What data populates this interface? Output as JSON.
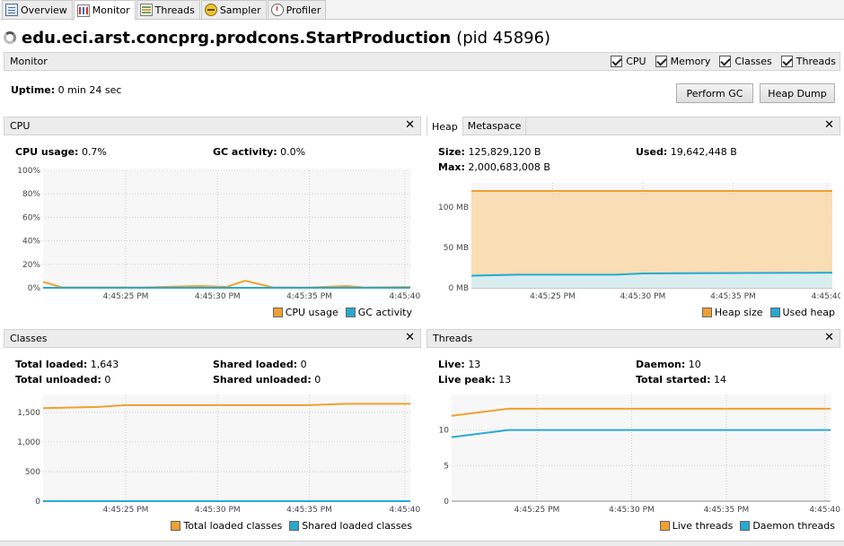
{
  "tabs": [
    {
      "label": "Overview"
    },
    {
      "label": "Monitor"
    },
    {
      "label": "Threads"
    },
    {
      "label": "Sampler"
    },
    {
      "label": "Profiler"
    }
  ],
  "app": {
    "title": "edu.eci.arst.concprg.prodcons.StartProduction",
    "pid": "(pid 45896)"
  },
  "monitor": {
    "label": "Monitor",
    "checks": [
      "CPU",
      "Memory",
      "Classes",
      "Threads"
    ],
    "uptime_label": "Uptime:",
    "uptime_value": "0 min 24 sec",
    "perform_gc": "Perform GC",
    "heap_dump": "Heap Dump"
  },
  "colors": {
    "orange": "#f0a030",
    "blue": "#28a8d0",
    "orange_fill": "#f8d9ad",
    "blue_fill": "#d6eff6"
  },
  "cpu": {
    "title": "CPU",
    "usage_label": "CPU usage:",
    "usage_value": "0.7%",
    "gc_label": "GC activity:",
    "gc_value": "0.0%",
    "legend": [
      "CPU usage",
      "GC activity"
    ]
  },
  "heap": {
    "tab_heap": "Heap",
    "tab_meta": "Metaspace",
    "size_label": "Size:",
    "size_value": "125,829,120 B",
    "used_label": "Used:",
    "used_value": "19,642,448 B",
    "max_label": "Max:",
    "max_value": "2,000,683,008 B",
    "legend": [
      "Heap size",
      "Used heap"
    ]
  },
  "classes": {
    "title": "Classes",
    "total_loaded_label": "Total loaded:",
    "total_loaded_value": "1,643",
    "total_unloaded_label": "Total unloaded:",
    "total_unloaded_value": "0",
    "shared_loaded_label": "Shared loaded:",
    "shared_loaded_value": "0",
    "shared_unloaded_label": "Shared unloaded:",
    "shared_unloaded_value": "0",
    "legend": [
      "Total loaded classes",
      "Shared loaded classes"
    ]
  },
  "threads": {
    "title": "Threads",
    "live_label": "Live:",
    "live_value": "13",
    "peak_label": "Live peak:",
    "peak_value": "13",
    "daemon_label": "Daemon:",
    "daemon_value": "10",
    "started_label": "Total started:",
    "started_value": "14",
    "legend": [
      "Live threads",
      "Daemon threads"
    ]
  },
  "chart_data": [
    {
      "type": "line",
      "name": "cpu",
      "x_ticks": [
        "4:45:25 PM",
        "4:45:30 PM",
        "4:45:35 PM",
        "4:45:40"
      ],
      "y_ticks": [
        "100%",
        "80%",
        "60%",
        "40%",
        "20%",
        "0%"
      ],
      "ylim": [
        0,
        100
      ],
      "xlim": [
        20.5,
        40.5
      ],
      "series": [
        {
          "name": "CPU usage",
          "x": [
            20.5,
            21.5,
            26,
            29,
            30.5,
            31.5,
            33,
            35,
            37,
            38,
            40.5
          ],
          "values": [
            5,
            0.5,
            0.3,
            1.5,
            0.8,
            6,
            0.4,
            0.2,
            1.5,
            0.3,
            0.7
          ]
        },
        {
          "name": "GC activity",
          "x": [
            20.5,
            40.5
          ],
          "values": [
            0,
            0
          ]
        }
      ]
    },
    {
      "type": "area",
      "name": "heap",
      "x_ticks": [
        "4:45:25 PM",
        "4:45:30 PM",
        "4:45:35 PM",
        "4:45:40"
      ],
      "y_ticks": [
        "100 MB",
        "50 MB",
        "0 MB"
      ],
      "ylim": [
        0,
        130
      ],
      "xlim": [
        20.5,
        40.5
      ],
      "series": [
        {
          "name": "Heap size",
          "x": [
            20.5,
            40.5
          ],
          "values": [
            120,
            120
          ]
        },
        {
          "name": "Used heap",
          "x": [
            20.5,
            23,
            28.5,
            30,
            40.5
          ],
          "values": [
            15,
            16.3,
            16.3,
            17.8,
            18.7
          ]
        }
      ]
    },
    {
      "type": "line",
      "name": "classes",
      "x_ticks": [
        "4:45:25 PM",
        "4:45:30 PM",
        "4:45:35 PM",
        "4:45:40"
      ],
      "y_ticks": [
        "1,500",
        "1,000",
        "500",
        "0"
      ],
      "ylim": [
        0,
        1800
      ],
      "xlim": [
        20.5,
        40.5
      ],
      "series": [
        {
          "name": "Total loaded classes",
          "x": [
            20.5,
            23.5,
            25,
            35,
            37,
            40.5
          ],
          "values": [
            1570,
            1590,
            1620,
            1620,
            1643,
            1643
          ]
        },
        {
          "name": "Shared loaded classes",
          "x": [
            20.5,
            40.5
          ],
          "values": [
            0,
            0
          ]
        }
      ]
    },
    {
      "type": "line",
      "name": "threads",
      "x_ticks": [
        "4:45:25 PM",
        "4:45:30 PM",
        "4:45:35 PM",
        "4:45:40"
      ],
      "y_ticks": [
        "10",
        "5",
        "0"
      ],
      "ylim": [
        0,
        15
      ],
      "xlim": [
        20.5,
        40.5
      ],
      "series": [
        {
          "name": "Live threads",
          "x": [
            20.5,
            23.5,
            40.5
          ],
          "values": [
            12,
            13,
            13
          ]
        },
        {
          "name": "Daemon threads",
          "x": [
            20.5,
            23.5,
            40.5
          ],
          "values": [
            9,
            10,
            10
          ]
        }
      ]
    }
  ]
}
